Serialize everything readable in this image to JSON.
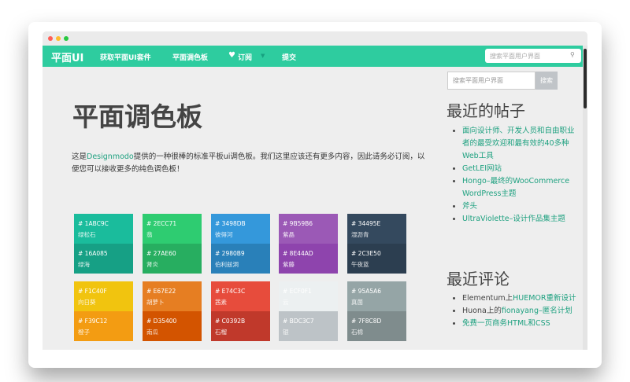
{
  "colors": {
    "accent": "#2ecc9f",
    "link": "#1fa180"
  },
  "navbar": {
    "brand": "平面UI",
    "links": [
      "获取平面UI套件",
      "平面调色板",
      "订阅",
      "提交"
    ],
    "heart_icon": "heart-icon",
    "search_placeholder": "搜索平面用户界面",
    "search_icon": "search-icon"
  },
  "main": {
    "title": "平面调色板",
    "intro_before": "这是",
    "intro_link": "Designmodo",
    "intro_after": "提供的一种很棒的标准平板ui调色板。我们这里应该还有更多内容，因此请务必订阅，以便您可以接收更多的纯色调色板！"
  },
  "palette": [
    {
      "top": {
        "hex": "# 1ABC9C",
        "name": "绿松石",
        "color": "#1abc9c"
      },
      "bottom": {
        "hex": "# 16A085",
        "name": "绿海",
        "color": "#16a085"
      }
    },
    {
      "top": {
        "hex": "# 2ECC71",
        "name": "翡",
        "color": "#2ecc71"
      },
      "bottom": {
        "hex": "# 27AE60",
        "name": "肾炎",
        "color": "#27ae60"
      }
    },
    {
      "top": {
        "hex": "# 3498DB",
        "name": "彼得河",
        "color": "#3498db"
      },
      "bottom": {
        "hex": "# 2980B9",
        "name": "伯利兹洞",
        "color": "#2980b9"
      }
    },
    {
      "top": {
        "hex": "# 9B59B6",
        "name": "紫晶",
        "color": "#9b59b6"
      },
      "bottom": {
        "hex": "# 8E44AD",
        "name": "紫藤",
        "color": "#8e44ad"
      }
    },
    {
      "top": {
        "hex": "# 34495E",
        "name": "湿沥青",
        "color": "#34495e"
      },
      "bottom": {
        "hex": "# 2C3E50",
        "name": "午夜蓝",
        "color": "#2c3e50"
      }
    },
    {
      "top": {
        "hex": "# F1C40F",
        "name": "向日葵",
        "color": "#f1c40f"
      },
      "bottom": {
        "hex": "# F39C12",
        "name": "橙子",
        "color": "#f39c12"
      }
    },
    {
      "top": {
        "hex": "# E67E22",
        "name": "胡萝卜",
        "color": "#e67e22"
      },
      "bottom": {
        "hex": "# D35400",
        "name": "南瓜",
        "color": "#d35400"
      }
    },
    {
      "top": {
        "hex": "# E74C3C",
        "name": "茜素",
        "color": "#e74c3c"
      },
      "bottom": {
        "hex": "# C0392B",
        "name": "石榴",
        "color": "#c0392b"
      }
    },
    {
      "top": {
        "hex": "# ECF0F1",
        "name": "云",
        "color": "#ecf0f1"
      },
      "bottom": {
        "hex": "# BDC3C7",
        "name": "银",
        "color": "#bdc3c7"
      }
    },
    {
      "top": {
        "hex": "# 95A5A6",
        "name": "真菌",
        "color": "#95a5a6"
      },
      "bottom": {
        "hex": "# 7F8C8D",
        "name": "石棉",
        "color": "#7f8c8d"
      }
    }
  ],
  "sidebar": {
    "search_placeholder": "搜索平面用户界面",
    "search_button": "搜索",
    "recent_posts_title": "最近的帖子",
    "recent_posts": [
      "面向设计师、开发人员和自由职业者的最受欢迎和最有效的40多种Web工具",
      "GetLEI网站",
      "Hongo–最终的WooCommerce WordPress主题",
      "斧头",
      "UltraViolette–设计作品集主题"
    ],
    "recent_comments_title": "最近评论",
    "recent_comments": [
      {
        "author": "Elementum",
        "mid": "上",
        "post": "HUEMOR重新设计"
      },
      {
        "author": "Huona",
        "mid": "上的",
        "post": "fionayang–匿名计划"
      },
      {
        "author": "免费一页商务HTML和CSS",
        "mid": "",
        "post": ""
      }
    ]
  }
}
